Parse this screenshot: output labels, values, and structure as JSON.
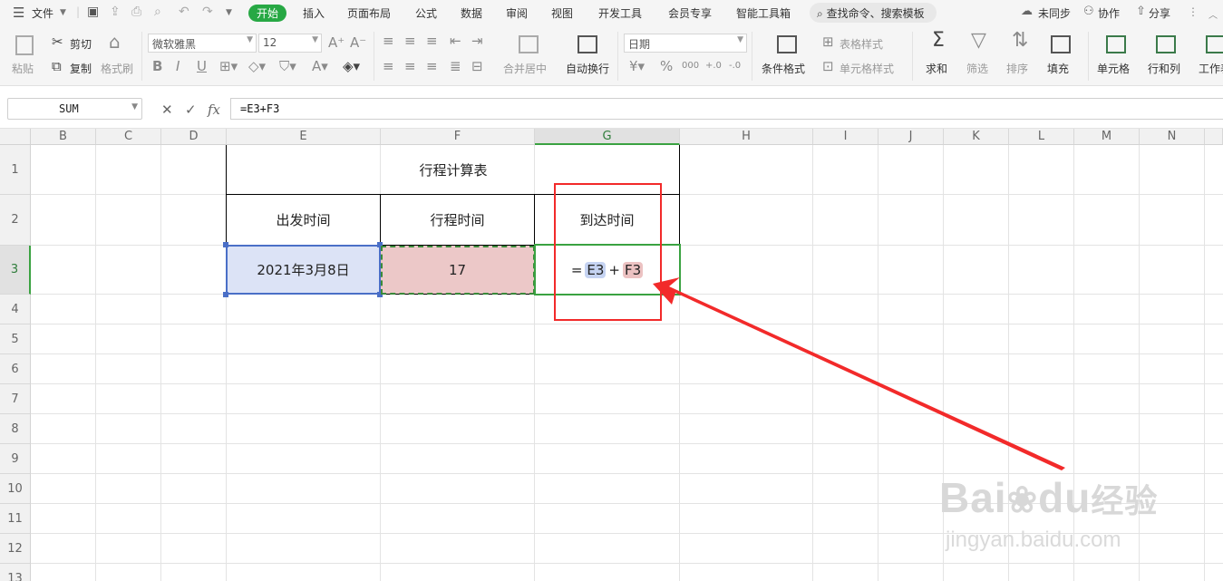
{
  "menubar": {
    "file": "文件",
    "tabs": [
      "开始",
      "插入",
      "页面布局",
      "公式",
      "数据",
      "审阅",
      "视图",
      "开发工具",
      "会员专享",
      "智能工具箱"
    ],
    "search_placeholder": "查找命令、搜索模板",
    "sync": "未同步",
    "collab": "协作",
    "share": "分享"
  },
  "ribbon": {
    "paste": "粘贴",
    "cut": "剪切",
    "copy": "复制",
    "format_painter": "格式刷",
    "font_name": "微软雅黑",
    "font_size": "12",
    "merge_center": "合并居中",
    "wrap_text": "自动换行",
    "number_format": "日期",
    "cond_format": "条件格式",
    "table_style": "表格样式",
    "cell_style": "单元格样式",
    "sum": "求和",
    "filter": "筛选",
    "sort": "排序",
    "fill": "填充",
    "cell": "单元格",
    "row_col": "行和列",
    "worksheet": "工作表"
  },
  "formula_bar": {
    "name_box": "SUM",
    "formula": "=E3+F3",
    "fx": "fx"
  },
  "grid": {
    "columns": [
      "B",
      "C",
      "D",
      "E",
      "F",
      "G",
      "H",
      "I",
      "J",
      "K",
      "L",
      "M",
      "N"
    ],
    "rows": [
      "1",
      "2",
      "3",
      "4",
      "5",
      "6",
      "7",
      "8",
      "9",
      "10",
      "11",
      "12",
      "13"
    ],
    "title": "行程计算表",
    "headers": [
      "出发时间",
      "行程时间",
      "到达时间"
    ],
    "e3": "2021年3月8日",
    "f3": "17",
    "g3_eq": "=",
    "g3_ref1": "E3",
    "g3_plus": "+",
    "g3_ref2": "F3"
  },
  "watermark": {
    "brand": "Bai",
    "brand2": "du",
    "brand3": "经验",
    "url": "jingyan.baidu.com"
  },
  "colors": {
    "accent_green": "#27a844",
    "e3_fill": "#dce3f6",
    "f3_fill": "#ecc8c8",
    "annotation_red": "#f22a2a"
  }
}
